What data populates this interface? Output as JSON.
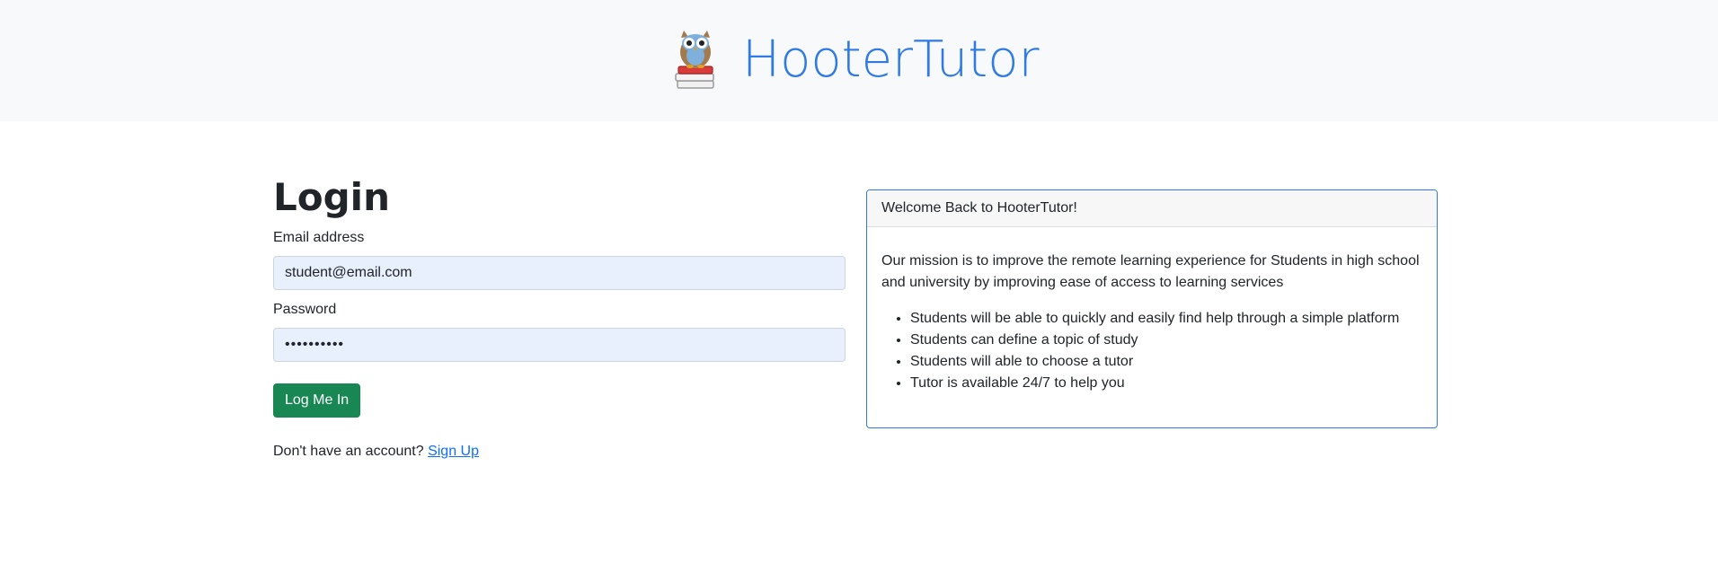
{
  "header": {
    "brand_name": "HooterTutor",
    "logo_icon": "owl-on-books-icon",
    "brand_color": "#2f7ae5"
  },
  "login": {
    "title": "Login",
    "email_label": "Email address",
    "email_value": "student@email.com",
    "password_label": "Password",
    "password_value": "••••••••••",
    "submit_label": "Log Me In",
    "signup_prompt": "Don't have an account?",
    "signup_link": "Sign Up"
  },
  "info_card": {
    "header": "Welcome Back to HooterTutor!",
    "mission": "Our mission is to improve the remote learning experience for Students in high school and university by improving ease of access to learning services",
    "features": [
      "Students will be able to quickly and easily find help through a simple platform",
      "Students can define a topic of study",
      "Students will able to choose a tutor",
      "Tutor is available 24/7 to help you"
    ]
  },
  "colors": {
    "primary_button": "#198754",
    "link": "#0d6efd",
    "input_autofill_bg": "#e8f0fe",
    "header_bg": "#f8f9fa"
  }
}
